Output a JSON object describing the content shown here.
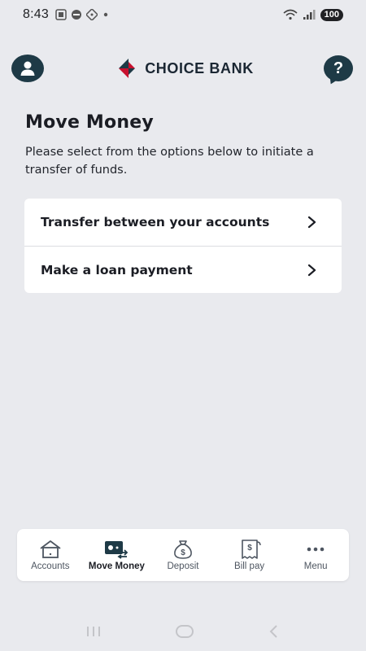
{
  "status_bar": {
    "time": "8:43",
    "battery": "100"
  },
  "header": {
    "logo_text": "CHOICE BANK",
    "brand_colors": {
      "navy": "#1e3a46",
      "red": "#c8102e",
      "dark": "#1b2733"
    }
  },
  "main": {
    "title": "Move Money",
    "subtitle": "Please select from the options below to initiate a transfer of funds.",
    "options": [
      {
        "label": "Transfer between your accounts",
        "icon": "chevron-right-icon"
      },
      {
        "label": "Make a loan payment",
        "icon": "chevron-right-icon"
      }
    ]
  },
  "bottom_nav": {
    "active": "Move Money",
    "items": [
      {
        "label": "Accounts",
        "icon": "house-icon"
      },
      {
        "label": "Move Money",
        "icon": "money-transfer-icon"
      },
      {
        "label": "Deposit",
        "icon": "money-bag-icon"
      },
      {
        "label": "Bill pay",
        "icon": "bill-icon"
      },
      {
        "label": "Menu",
        "icon": "more-dots-icon"
      }
    ]
  },
  "system_nav": {
    "items": [
      "recent-apps-icon",
      "home-icon",
      "back-icon"
    ]
  }
}
